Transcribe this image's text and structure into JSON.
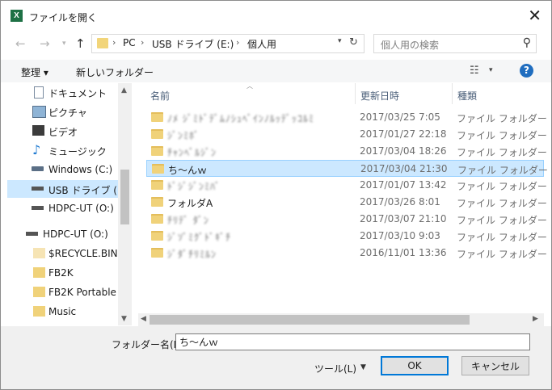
{
  "window": {
    "title": "ファイルを開く",
    "app_icon": "X"
  },
  "address": {
    "crumbs": [
      "PC",
      "USB ドライブ (E:)",
      "個人用"
    ],
    "search_placeholder": "個人用の検索"
  },
  "toolbar": {
    "organize": "整理 ▾",
    "new_folder": "新しいフォルダー"
  },
  "navpane": {
    "items": [
      {
        "label": "ドキュメント",
        "icon": "documents-icon"
      },
      {
        "label": "ピクチャ",
        "icon": "pictures-icon"
      },
      {
        "label": "ビデオ",
        "icon": "videos-icon"
      },
      {
        "label": "ミュージック",
        "icon": "music-icon"
      },
      {
        "label": "Windows (C:)",
        "icon": "drive-icon"
      },
      {
        "label": "USB ドライブ (E:)",
        "icon": "usb-drive-icon"
      },
      {
        "label": "HDPC-UT (O:)",
        "icon": "drive-icon"
      },
      {
        "label": "HDPC-UT (O:)",
        "icon": "drive-icon"
      },
      {
        "label": "$RECYCLE.BIN",
        "icon": "folder-icon"
      },
      {
        "label": "FB2K",
        "icon": "folder-icon"
      },
      {
        "label": "FB2K Portable",
        "icon": "folder-icon"
      },
      {
        "label": "Music",
        "icon": "folder-icon"
      }
    ]
  },
  "columns": {
    "name": "名前",
    "date": "更新日時",
    "type": "種類"
  },
  "files": [
    {
      "name": "ﾉﾒ ｼﾞﾐﾄﾞﾃﾞﾑﾉｼｭﾍﾞｲﾝﾉﾙｯﾃﾞｯｺﾙﾐ",
      "date": "2017/03/25 7:05",
      "type": "ファイル フォルダー"
    },
    {
      "name": "ｼﾞﾝﾐﾎﾞ",
      "date": "2017/01/27 22:18",
      "type": "ファイル フォルダー"
    },
    {
      "name": "ﾁｬﾝﾍﾞﾙｼﾞﾝ",
      "date": "2017/03/04 18:26",
      "type": "ファイル フォルダー"
    },
    {
      "name": "ち〜んｗ",
      "date": "2017/03/04 21:30",
      "type": "ファイル フォルダー"
    },
    {
      "name": "ﾄﾞｼﾞｼﾞﾝﾐﾊﾞ",
      "date": "2017/01/07 13:42",
      "type": "ファイル フォルダー"
    },
    {
      "name": "フォルダA",
      "date": "2017/03/26 8:01",
      "type": "ファイル フォルダー"
    },
    {
      "name": "ﾁﾘﾃﾞ ﾀﾞﾝ",
      "date": "2017/03/07 21:10",
      "type": "ファイル フォルダー"
    },
    {
      "name": "ｼﾞｿﾞﾐｸﾞﾄﾞｷﾞﾁ",
      "date": "2017/03/10 9:03",
      "type": "ファイル フォルダー"
    },
    {
      "name": "ｼﾞﾀﾞﾁﾘﾐﾙﾝ",
      "date": "2016/11/01 13:36",
      "type": "ファイル フォルダー"
    }
  ],
  "bottom": {
    "folder_name_label": "フォルダー名(N):",
    "folder_name_value": "ち〜んｗ",
    "tools": "ツール(L)",
    "ok": "OK",
    "cancel": "キャンセル"
  }
}
